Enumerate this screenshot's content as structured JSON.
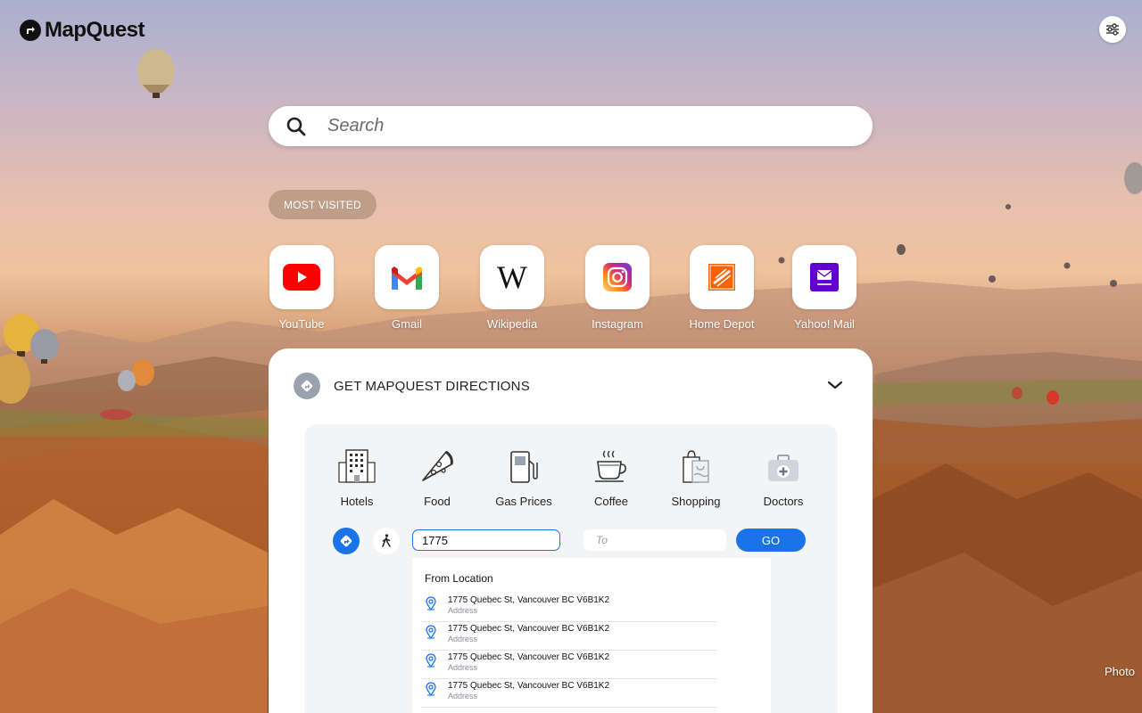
{
  "brand": {
    "name": "MapQuest"
  },
  "header": {
    "settings_icon": "sliders-icon"
  },
  "search": {
    "placeholder": "Search"
  },
  "most_visited": {
    "label": "MOST VISITED",
    "tiles": [
      {
        "label": "YouTube",
        "icon": "youtube-icon",
        "color": "#ff0000"
      },
      {
        "label": "Gmail",
        "icon": "gmail-icon",
        "color": "#ea4335"
      },
      {
        "label": "Wikipedia",
        "icon": "wikipedia-icon",
        "color": "#111111"
      },
      {
        "label": "Instagram",
        "icon": "instagram-icon",
        "color": "#d62976"
      },
      {
        "label": "Home Depot",
        "icon": "home-depot-icon",
        "color": "#f96302"
      },
      {
        "label": "Yahoo! Mail",
        "icon": "yahoo-mail-icon",
        "color": "#6001d2"
      }
    ]
  },
  "directions": {
    "title": "GET MAPQUEST DIRECTIONS",
    "categories": [
      {
        "label": "Hotels",
        "icon": "hotel-icon"
      },
      {
        "label": "Food",
        "icon": "pizza-icon"
      },
      {
        "label": "Gas Prices",
        "icon": "gas-pump-icon"
      },
      {
        "label": "Coffee",
        "icon": "coffee-icon"
      },
      {
        "label": "Shopping",
        "icon": "shopping-bag-icon"
      },
      {
        "label": "Doctors",
        "icon": "medical-kit-icon"
      }
    ],
    "from_value": "1775",
    "to_placeholder": "To",
    "go_label": "GO",
    "suggestions_header": "From Location",
    "suggestions": [
      {
        "address": "1775 Quebec St, Vancouver BC V6B1K2",
        "type": "Address"
      },
      {
        "address": "1775 Quebec St, Vancouver BC V6B1K2",
        "type": "Address"
      },
      {
        "address": "1775 Quebec St, Vancouver BC V6B1K2",
        "type": "Address"
      },
      {
        "address": "1775 Quebec St, Vancouver BC V6B1K2",
        "type": "Address"
      }
    ],
    "accent_color": "#1a73e8"
  },
  "photo_credit": "Photo"
}
